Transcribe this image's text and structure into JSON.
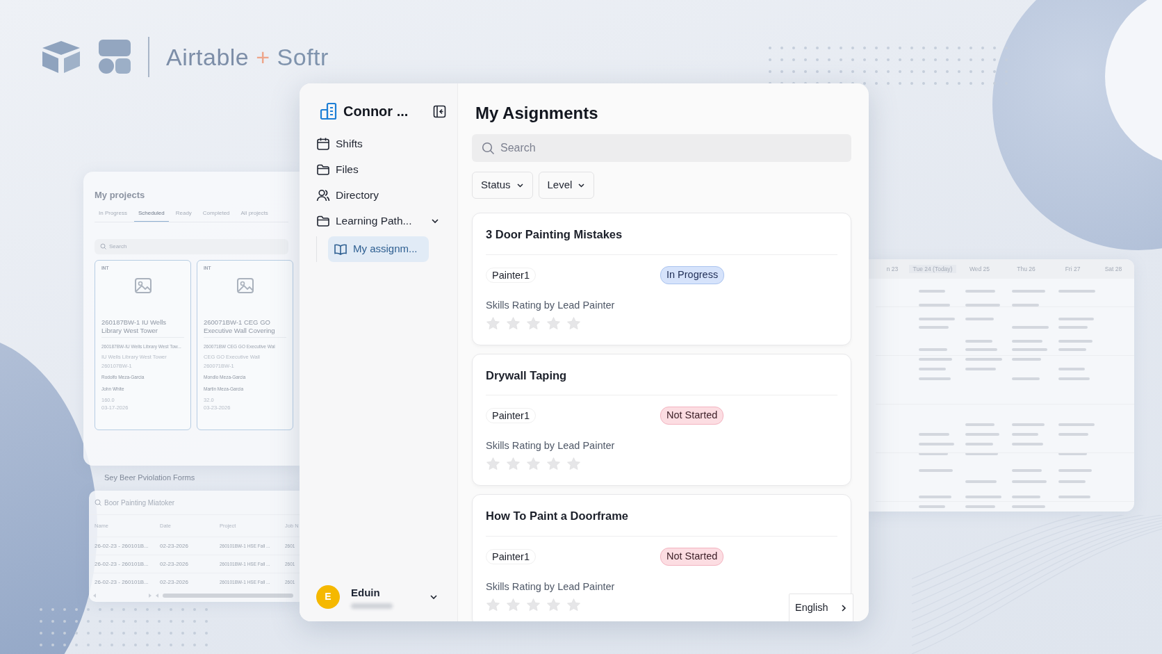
{
  "brand": {
    "parts": [
      "Airtable",
      "+",
      "Softr"
    ]
  },
  "projects_panel": {
    "title": "My projects",
    "tabs": [
      {
        "label": "In Progress",
        "selected": false
      },
      {
        "label": "Scheduled",
        "selected": true
      },
      {
        "label": "Ready",
        "selected": false
      },
      {
        "label": "Completed",
        "selected": false
      },
      {
        "label": "All projects",
        "selected": false
      }
    ],
    "search": {
      "placeholder": "Search"
    },
    "cards": [
      {
        "tag": "INT",
        "title": "260187BW-1 IU Wells Library West Tower",
        "subtitle": "260187BW-IU Wells Library West Tow...",
        "lines": [
          "IU Wells Library West Tower",
          "260107BW-1"
        ],
        "people": [
          "Rodolfo Meza-Garcia",
          "John White"
        ],
        "hours": "160.0",
        "date": "03-17-2026"
      },
      {
        "tag": "INT",
        "title": "260071BW-1 CEG GO Executive Wall Covering",
        "subtitle": "260071BW CEG GO Executive Wal",
        "lines": [
          "CEG GO Executive Wall",
          "260071BW-1"
        ],
        "people": [
          "Mondlo Meza-Garcia",
          "Martin Meza-Garcia"
        ],
        "hours": "32.0",
        "date": "03-23-2026"
      }
    ]
  },
  "forms_panel": {
    "title": "Sey Beer Pviolation Forms",
    "search": {
      "value": "Boor Painting Miatoker"
    },
    "columns": [
      "Name",
      "Date",
      "Project",
      "Job N"
    ],
    "rows": [
      [
        "26-02-23 - 260101B...",
        "02-23-2026",
        "260101BW-1 HSE Fall ...",
        "2601"
      ],
      [
        "26-02-23 - 260101B...",
        "02-23-2026",
        "260101BW-1 HSE Fall ...",
        "2601"
      ],
      [
        "26-02-23 - 260101B...",
        "02-23-2026",
        "260101BW-1 HSE Fall ...",
        "2601"
      ]
    ]
  },
  "calendar": {
    "columns": [
      "n 23",
      "Tue 24 (Today)",
      "Wed 25",
      "Thu 26",
      "Fri 27",
      "Sat 28"
    ]
  },
  "app": {
    "workspace": "Connor ...",
    "nav": [
      {
        "label": "Shifts",
        "kind": "calendar",
        "selected": false
      },
      {
        "label": "Files",
        "kind": "folder",
        "selected": false
      },
      {
        "label": "Directory",
        "kind": "people",
        "selected": false
      },
      {
        "label": "Learning Path...",
        "kind": "folder",
        "selected": false,
        "expanded": true,
        "children": [
          {
            "label": "My assignm...",
            "kind": "book",
            "selected": true
          }
        ]
      }
    ],
    "user": {
      "initial": "E",
      "name": "Eduin"
    },
    "title": "My Asignments",
    "search": {
      "placeholder": "Search"
    },
    "filters": [
      "Status",
      "Level"
    ],
    "cards": [
      {
        "title": "3 Door Painting Mistakes",
        "role": "Painter1",
        "status": "In Progress",
        "kind": "in-progress",
        "rating_label": "Skills Rating by Lead Painter",
        "stars": 0
      },
      {
        "title": "Drywall Taping",
        "role": "Painter1",
        "status": "Not Started",
        "kind": "not-started",
        "rating_label": "Skills Rating by Lead Painter",
        "stars": 0
      },
      {
        "title": "How To Paint a Doorframe",
        "role": "Painter1",
        "status": "Not Started",
        "kind": "not-started",
        "rating_label": "Skills Rating by Lead Painter",
        "stars": 0
      }
    ],
    "language": "English"
  }
}
